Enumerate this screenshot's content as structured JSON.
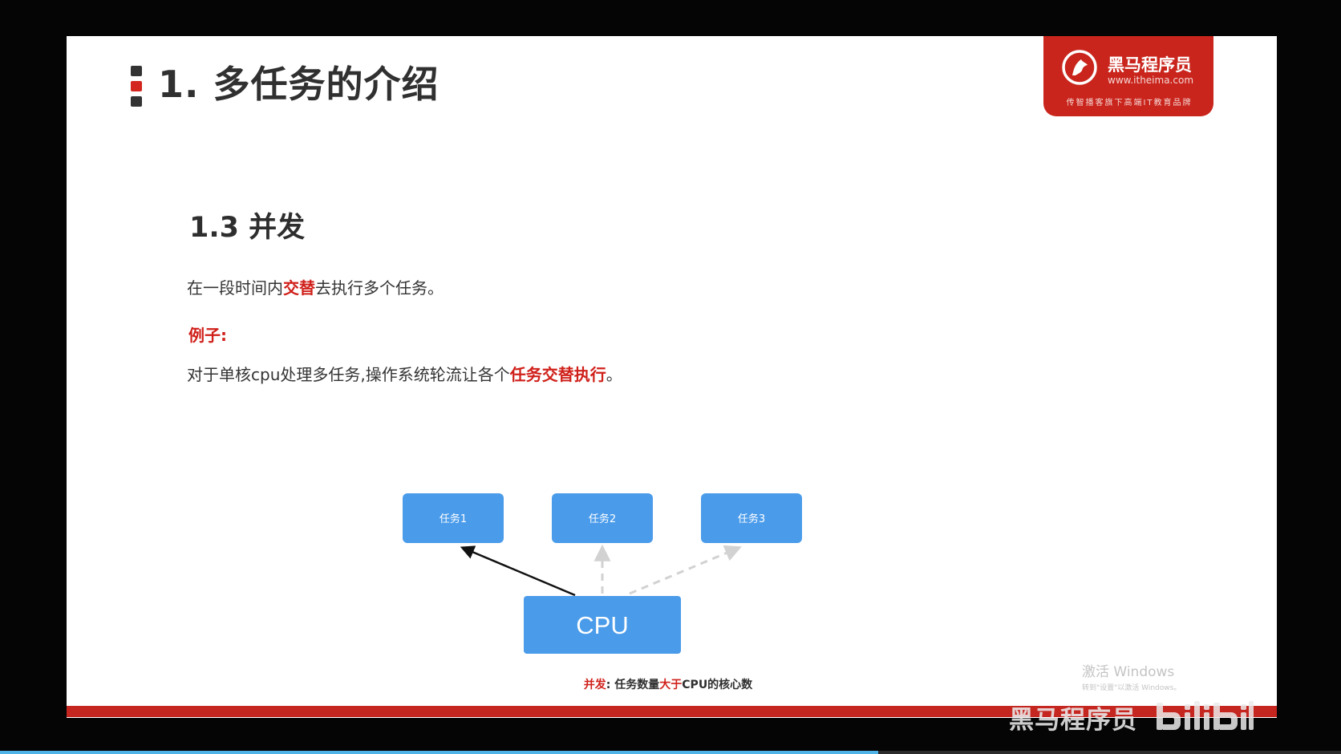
{
  "slide": {
    "title": "1. 多任务的介绍",
    "logo": {
      "name": "黑马程序员",
      "url": "www.itheima.com",
      "slogan": "传智播客旗下高端IT教育品牌"
    },
    "section_title": "1.3 并发",
    "definition": {
      "before": "在一段时间内",
      "highlight": "交替",
      "after": "去执行多个任务。"
    },
    "example_label": "例子:",
    "example": {
      "before": "对于单核cpu处理多任务,操作系统轮流让各个",
      "highlight": "任务交替执行",
      "after": "。"
    },
    "diagram": {
      "tasks": [
        "任务1",
        "任务2",
        "任务3"
      ],
      "cpu_label": "CPU",
      "active_task_index": 0
    },
    "caption": {
      "term": "并发",
      "colon": ": ",
      "text_before": "任务数量",
      "highlight": "大于",
      "text_after": "CPU的核心数"
    }
  },
  "watermarks": {
    "activate_title": "激活 Windows",
    "activate_subtitle": "转到\"设置\"以激活 Windows。",
    "brand": "黑马程序员",
    "bili_logo": "bilibili-logo"
  },
  "player": {
    "progress_fraction": 0.655
  },
  "colors": {
    "accent_red": "#d0201a",
    "task_blue": "#4a9bea",
    "logo_red": "#c9251c",
    "progress_blue": "#4fb3e8"
  }
}
